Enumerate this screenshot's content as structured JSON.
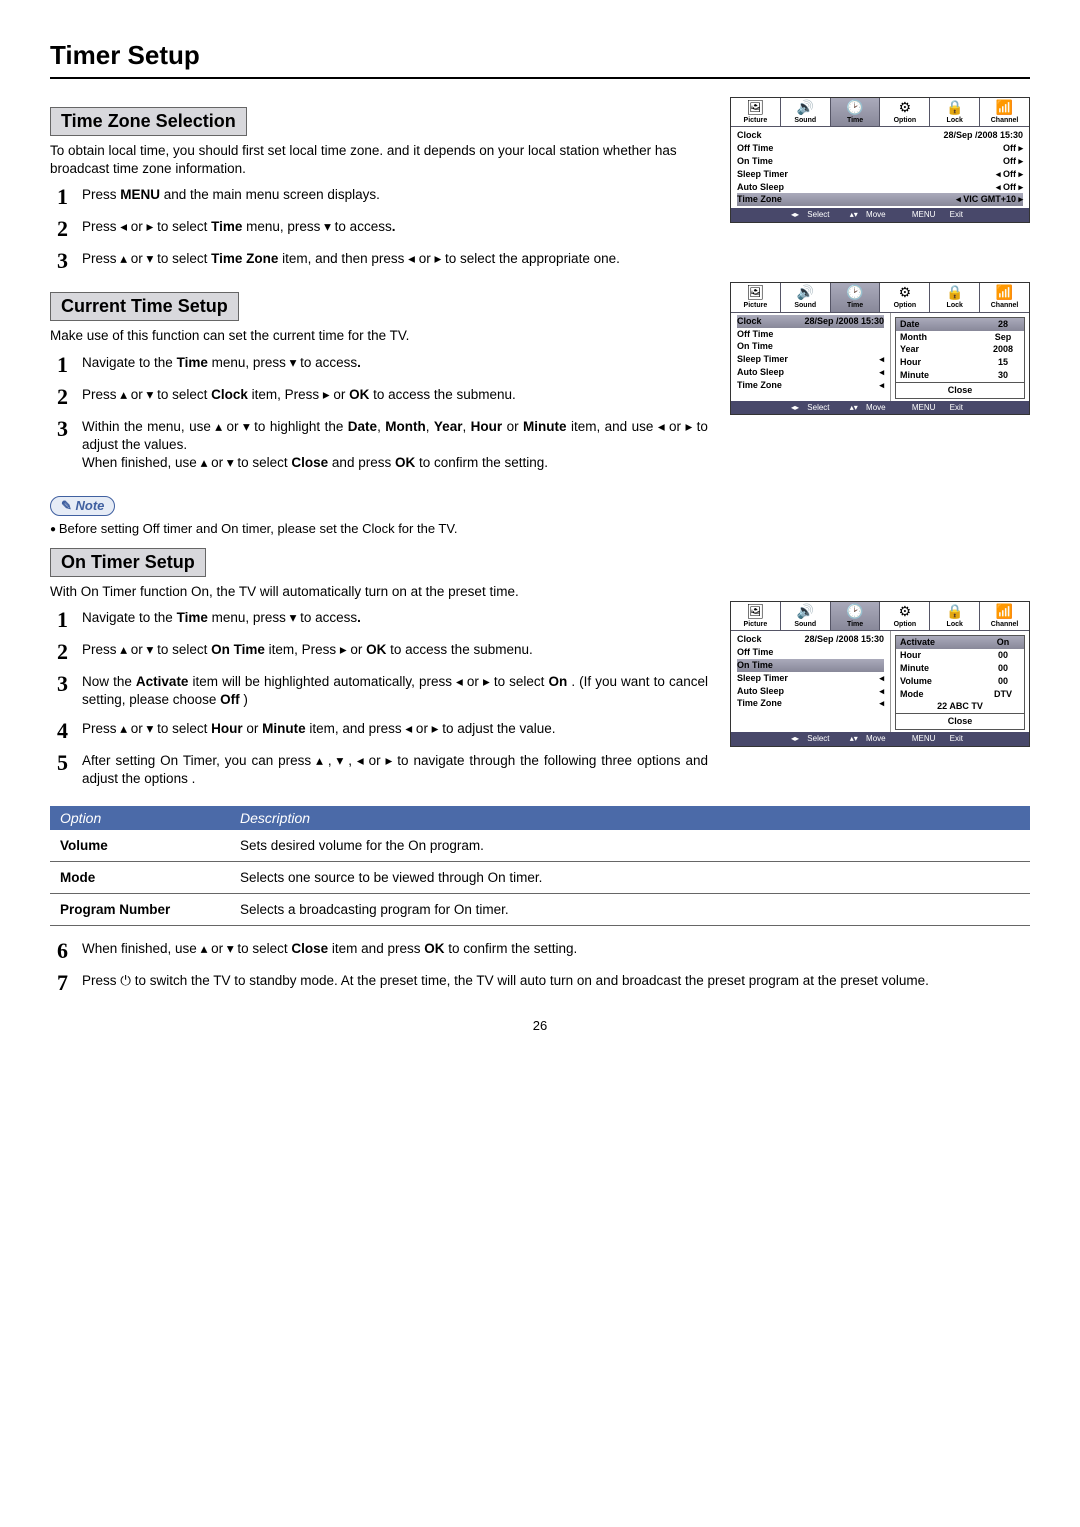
{
  "page": {
    "title": "Timer Setup",
    "number": "26"
  },
  "osdTabs": [
    {
      "icon": "🖼",
      "label": "Picture"
    },
    {
      "icon": "🔊",
      "label": "Sound"
    },
    {
      "icon": "🕑",
      "label": "Time"
    },
    {
      "icon": "⚙",
      "label": "Option"
    },
    {
      "icon": "🔒",
      "label": "Lock"
    },
    {
      "icon": "📶",
      "label": "Channel"
    }
  ],
  "osdFooter": {
    "select": "Select",
    "move": "Move",
    "exit": "Exit",
    "menu": "MENU"
  },
  "tz": {
    "title": "Time Zone Selection",
    "intro": "To obtain local time, you should first set local time zone. and it depends on your local station whether has broadcast time zone information.",
    "s1a": "Press ",
    "s1b": "MENU",
    "s1c": " and the main menu screen displays.",
    "s2a": "Press ◂ or ▸ to select ",
    "s2b": "Time",
    "s2c": " menu,  press ▾ to access",
    "s2d": ".",
    "s3a": "Press ▴ or ▾ to select ",
    "s3b": "Time Zone",
    "s3c": " item, and then press ◂ or ▸ to select the appropriate one.",
    "osd": {
      "clockValue": "28/Sep /2008 15:30",
      "rows": {
        "clock": "Clock",
        "off": "Off Time",
        "on": "On Time",
        "sleep": "Sleep Timer",
        "auto": "Auto Sleep",
        "zone": "Time Zone",
        "offVal": "Off",
        "zoneVal": "VIC GMT+10"
      }
    }
  },
  "ct": {
    "title": "Current Time Setup",
    "intro": "Make use of this function can set the current time for the TV.",
    "s1a": "Navigate to the ",
    "s1b": "Time",
    "s1c": " menu,  press ▾ to access",
    "s1d": ".",
    "s2a": "Press ▴ or ▾ to select ",
    "s2b": "Clock",
    "s2c": " item, Press ▸ or ",
    "s2d": "OK",
    "s2e": " to access the submenu.",
    "s3a": "Within the menu, use ▴ or ▾ to highlight the ",
    "s3b": "Date",
    "s3c": ", ",
    "s3d": "Month",
    "s3e": ", ",
    "s3f": "Year",
    "s3g": ", ",
    "s3h": "Hour",
    "s3i": " or ",
    "s3j": "Minute",
    "s3k": " item, and use ◂ or ▸ to adjust the values.",
    "s3l": "When finished, use ▴ or ▾ to select ",
    "s3m": "Close",
    "s3n": " and press ",
    "s3o": "OK",
    "s3p": " to confirm the setting.",
    "noteLabel": "Note",
    "note": "Before setting Off timer and On timer, please set the Clock for the TV.",
    "osd": {
      "clockValue": "28/Sep /2008 15:30",
      "sub": {
        "date": "Date",
        "dateV": "28",
        "month": "Month",
        "monthV": "Sep",
        "year": "Year",
        "yearV": "2008",
        "hour": "Hour",
        "hourV": "15",
        "minute": "Minute",
        "minuteV": "30",
        "close": "Close"
      }
    }
  },
  "ot": {
    "title": "On Timer Setup",
    "intro": "With On Timer function On, the TV will automatically turn on at the preset time.",
    "s1a": "Navigate to the ",
    "s1b": "Time",
    "s1c": " menu,  press ▾ to access",
    "s1d": ".",
    "s2a": "Press ▴ or ▾ to select ",
    "s2b": "On Time",
    "s2c": " item, Press ▸ or ",
    "s2d": "OK",
    "s2e": " to access the submenu.",
    "s3a": "Now the ",
    "s3b": "Activate",
    "s3c": " item will be highlighted automatically, press ◂ or ▸ to select ",
    "s3d": "On",
    "s3e": " . (If you want to cancel setting, please choose ",
    "s3f": "Off",
    "s3g": " )",
    "s4a": "Press ▴ or ▾ to select ",
    "s4b": "Hour",
    "s4c": " or ",
    "s4d": "Minute",
    "s4e": " item, and press ◂ or ▸ to adjust the value.",
    "s5": "After setting On Timer, you can press ▴ , ▾ , ◂ or ▸ to navigate through the following three options and adjust the options .",
    "s6a": "When finished, use ▴ or ▾ to select ",
    "s6b": "Close",
    "s6c": " item and press ",
    "s6d": "OK",
    "s6e": " to confirm the setting.",
    "s7": "Press ⏻ to switch the TV to standby mode. At the preset time, the TV will auto turn on and broadcast the preset program at the preset volume.",
    "osd": {
      "clockValue": "28/Sep /2008 15:30",
      "sub": {
        "activate": "Activate",
        "activateV": "On",
        "hour": "Hour",
        "hourV": "00",
        "minute": "Minute",
        "minuteV": "00",
        "volume": "Volume",
        "volumeV": "00",
        "mode": "Mode",
        "modeV": "DTV",
        "prog": "22 ABC TV",
        "close": "Close"
      }
    },
    "table": {
      "hOption": "Option",
      "hDesc": "Description",
      "r1o": "Volume",
      "r1d": "Sets desired volume for the On program.",
      "r2o": "Mode",
      "r2d": "Selects one source to be viewed through On timer.",
      "r3o": "Program Number",
      "r3d": "Selects a broadcasting program for On timer."
    }
  }
}
